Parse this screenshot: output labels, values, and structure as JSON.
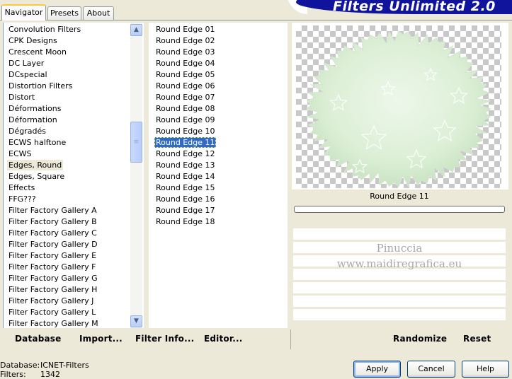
{
  "tabs": [
    {
      "label": "Navigator"
    },
    {
      "label": "Presets"
    },
    {
      "label": "About"
    }
  ],
  "brand": "Filters Unlimited 2.0",
  "categories": {
    "items": [
      "Convolution Filters",
      "CPK Designs",
      "Crescent Moon",
      "DC Layer",
      "DCspecial",
      "Distortion Filters",
      "Distort",
      "Déformations",
      "Déformation",
      "Dégradés",
      "ECWS halftone",
      "ECWS",
      "Edges, Round",
      "Edges, Square",
      "Effects",
      "FFG???",
      "Filter Factory Gallery A",
      "Filter Factory Gallery B",
      "Filter Factory Gallery C",
      "Filter Factory Gallery D",
      "Filter Factory Gallery E",
      "Filter Factory Gallery F",
      "Filter Factory Gallery G",
      "Filter Factory Gallery H",
      "Filter Factory Gallery J",
      "Filter Factory Gallery L",
      "Filter Factory Gallery M"
    ],
    "selected": "Edges, Round",
    "scrollbar": {
      "up_icon": "arrow-up-icon",
      "down_icon": "arrow-down-icon",
      "thumb_icon": "grip-icon"
    }
  },
  "filters": {
    "items": [
      "Round Edge 01",
      "Round Edge 02",
      "Round Edge 03",
      "Round Edge 04",
      "Round Edge 05",
      "Round Edge 06",
      "Round Edge 07",
      "Round Edge 08",
      "Round Edge 09",
      "Round Edge 10",
      "Round Edge 11",
      "Round Edge 12",
      "Round Edge 13",
      "Round Edge 14",
      "Round Edge 15",
      "Round Edge 16",
      "Round Edge 17",
      "Round Edge 18"
    ],
    "selected": "Round Edge 11"
  },
  "preview": {
    "name": "Round Edge 11",
    "watermark_line1": "Pinuccia",
    "watermark_line2": "www.maidiregrafica.eu",
    "colors": {
      "fill": "#dff0da",
      "checker": "#c8c8c8"
    }
  },
  "toolbar": {
    "database": "Database",
    "import": "Import...",
    "filter_info": "Filter Info...",
    "editor": "Editor...",
    "randomize": "Randomize",
    "reset": "Reset"
  },
  "status": {
    "database_label": "Database:",
    "database_value": "ICNET-Filters",
    "filters_label": "Filters:",
    "filters_value": "1342"
  },
  "buttons": {
    "apply": "Apply",
    "cancel": "Cancel",
    "help": "Help"
  },
  "colors": {
    "brand": "#10139c",
    "selection": "#316ac5",
    "dialog_bg": "#ece9d8"
  }
}
